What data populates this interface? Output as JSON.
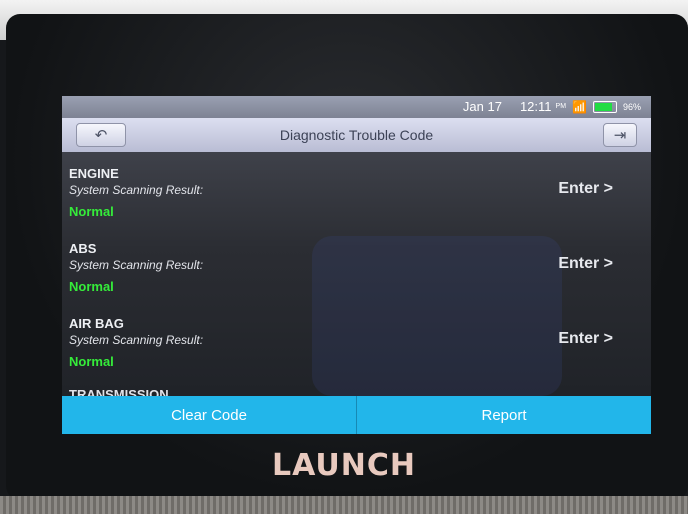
{
  "status": {
    "date": "Jan 17",
    "time": "12:11",
    "ampm": "PM",
    "battery_percent": "96%",
    "battery_level": 0.96,
    "wifi_icon": "wifi-icon"
  },
  "header": {
    "title": "Diagnostic Trouble Code",
    "back_icon": "back-arrow-icon",
    "exit_icon": "exit-icon"
  },
  "systems": [
    {
      "name": "ENGINE",
      "scan_label": "System Scanning Result:",
      "status": "Normal",
      "action": "Enter >"
    },
    {
      "name": "ABS",
      "scan_label": "System Scanning Result:",
      "status": "Normal",
      "action": "Enter >"
    },
    {
      "name": "AIR BAG",
      "scan_label": "System Scanning Result:",
      "status": "Normal",
      "action": "Enter >"
    },
    {
      "name": "TRANSMISSION"
    }
  ],
  "footer": {
    "clear_code": "Clear Code",
    "report": "Report"
  },
  "device": {
    "brand": "LAUNCH"
  },
  "colors": {
    "accent": "#22b6ea",
    "status_normal": "#35ec3a"
  }
}
